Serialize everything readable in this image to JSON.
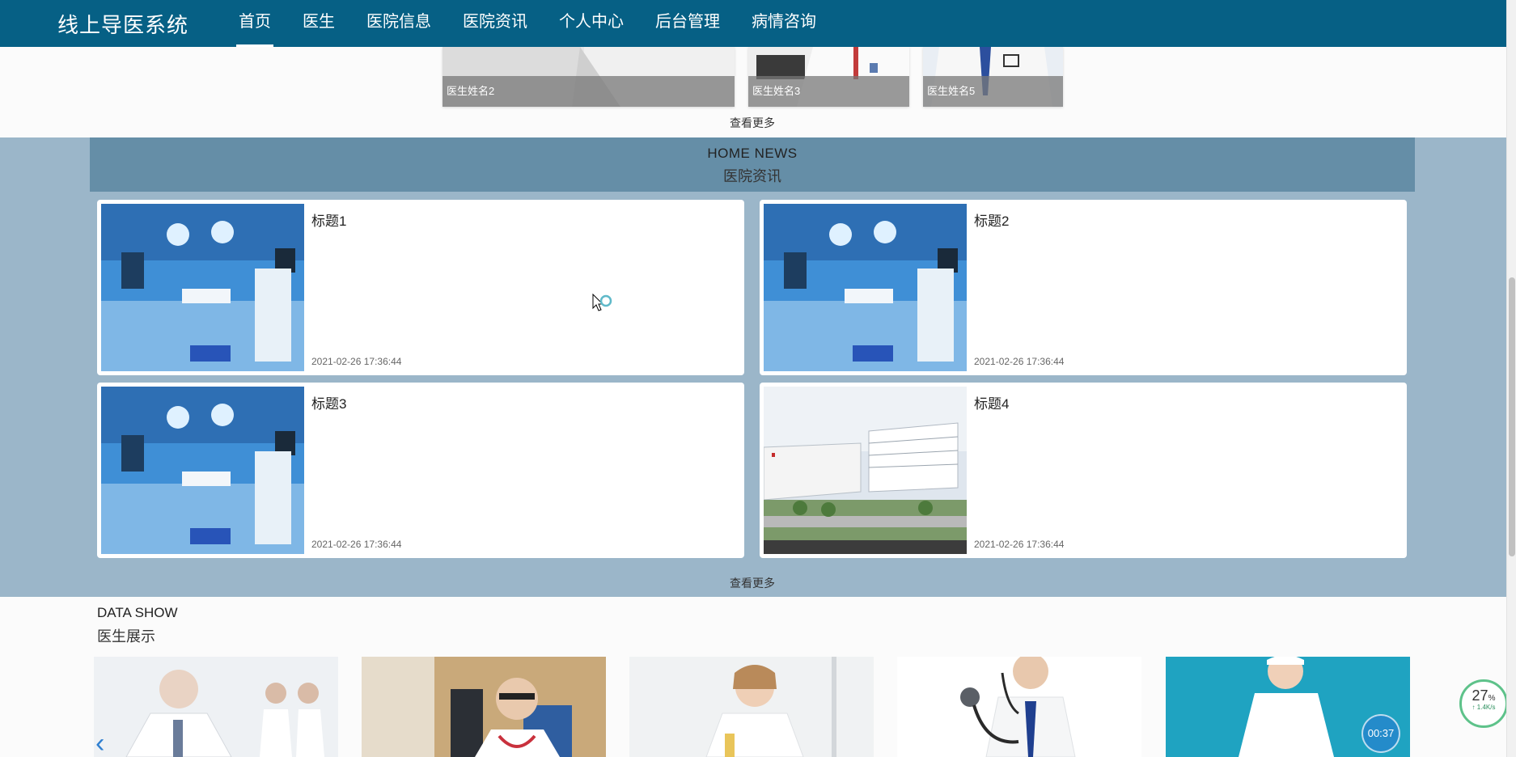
{
  "header": {
    "brand": "线上导医系统",
    "nav": [
      "首页",
      "医生",
      "医院信息",
      "医院资讯",
      "个人中心",
      "后台管理",
      "病情咨询"
    ],
    "active_index": 0
  },
  "top_doctors": {
    "items": [
      "医生姓名2",
      "医生姓名3",
      "医生姓名5"
    ],
    "more_label": "查看更多"
  },
  "news": {
    "heading_en": "HOME NEWS",
    "heading_cn": "医院资讯",
    "items": [
      {
        "title": "标题1",
        "date": "2021-02-26 17:36:44",
        "image": "operating-room"
      },
      {
        "title": "标题2",
        "date": "2021-02-26 17:36:44",
        "image": "operating-room"
      },
      {
        "title": "标题3",
        "date": "2021-02-26 17:36:44",
        "image": "operating-room"
      },
      {
        "title": "标题4",
        "date": "2021-02-26 17:36:44",
        "image": "hospital-building"
      }
    ],
    "more_label": "查看更多"
  },
  "data_show": {
    "heading_en": "DATA SHOW",
    "heading_cn": "医生展示"
  },
  "widgets": {
    "speed_percent": "27",
    "speed_unit": "%",
    "speed_rate": "↑ 1.4K/s",
    "timer": "00:37"
  },
  "colors": {
    "header": "#066085",
    "news_band": "#9bb6c9",
    "news_heading": "#658ea7"
  }
}
